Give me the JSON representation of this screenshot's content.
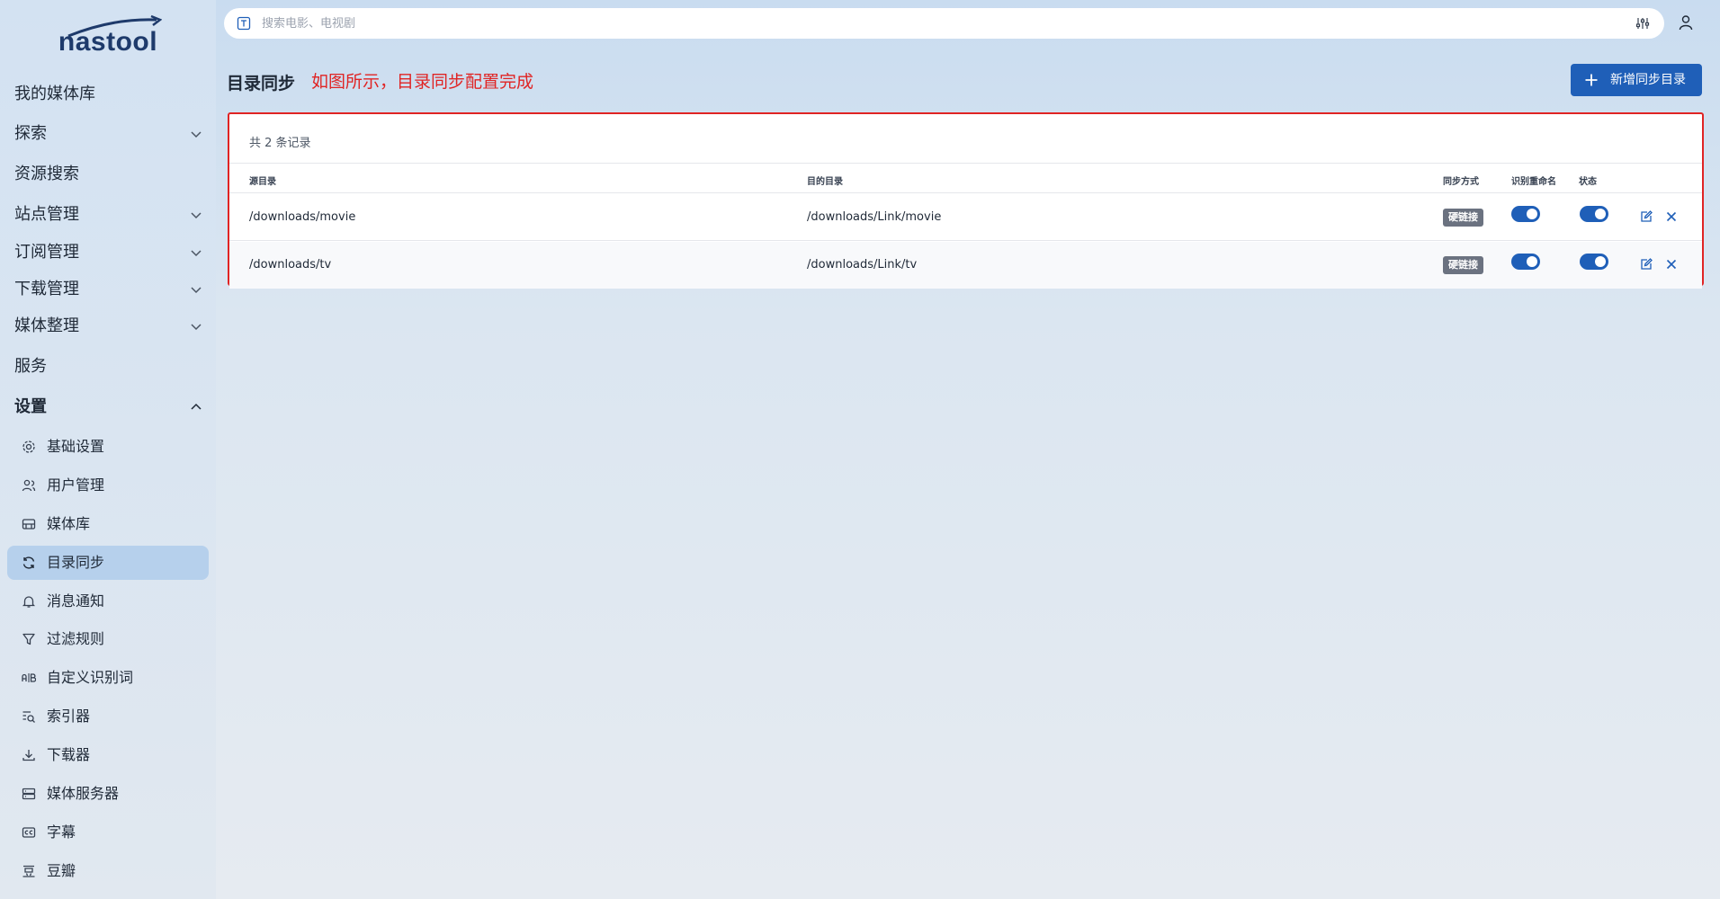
{
  "app": {
    "logo": "nastool"
  },
  "search": {
    "placeholder": "搜索电影、电视剧"
  },
  "sidebar": {
    "items": [
      {
        "label": "我的媒体库"
      },
      {
        "label": "探索"
      },
      {
        "label": "资源搜索"
      },
      {
        "label": "站点管理"
      },
      {
        "label": "订阅管理"
      },
      {
        "label": "下载管理"
      },
      {
        "label": "媒体整理"
      },
      {
        "label": "服务"
      },
      {
        "label": "设置"
      }
    ],
    "settings_items": [
      {
        "label": "基础设置",
        "icon": "gear-icon"
      },
      {
        "label": "用户管理",
        "icon": "users-icon"
      },
      {
        "label": "媒体库",
        "icon": "media-library-icon"
      },
      {
        "label": "目录同步",
        "icon": "sync-icon",
        "active": true
      },
      {
        "label": "消息通知",
        "icon": "bell-icon"
      },
      {
        "label": "过滤规则",
        "icon": "filter-icon"
      },
      {
        "label": "自定义识别词",
        "icon": "ab-icon"
      },
      {
        "label": "索引器",
        "icon": "list-search-icon"
      },
      {
        "label": "下载器",
        "icon": "download-icon"
      },
      {
        "label": "媒体服务器",
        "icon": "server-icon"
      },
      {
        "label": "字幕",
        "icon": "subtitle-icon"
      },
      {
        "label": "豆瓣",
        "icon": "douban-icon"
      }
    ]
  },
  "header": {
    "title": "目录同步",
    "annotation": "如图所示，目录同步配置完成",
    "add_button": "新增同步目录"
  },
  "table": {
    "total": "共 2 条记录",
    "columns": {
      "source": "源目录",
      "target": "目的目录",
      "mode": "同步方式",
      "rename": "识别重命名",
      "status": "状态"
    },
    "rows": [
      {
        "source": "/downloads/movie",
        "target": "/downloads/Link/movie",
        "mode": "硬链接",
        "rename": true,
        "status": true
      },
      {
        "source": "/downloads/tv",
        "target": "/downloads/Link/tv",
        "mode": "硬链接",
        "rename": true,
        "status": true
      }
    ]
  },
  "colors": {
    "primary": "#1f5fb8",
    "annotation": "#e02424",
    "active_nav": "#b6d0ec"
  }
}
